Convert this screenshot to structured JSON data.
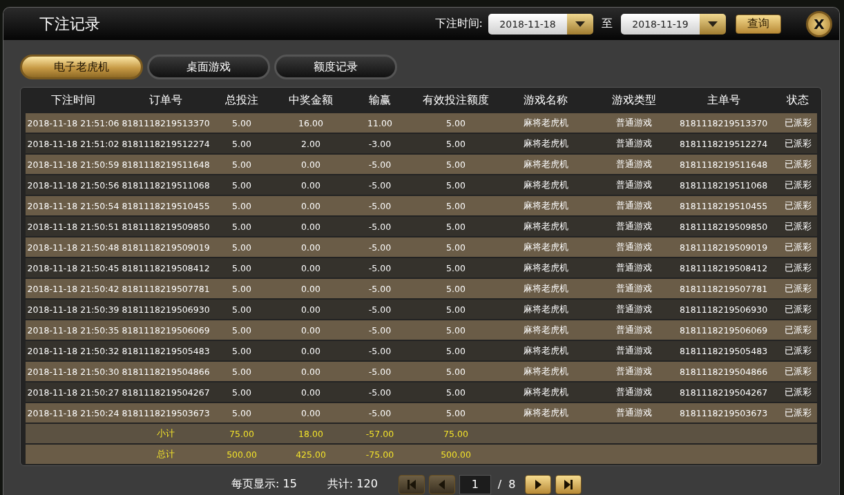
{
  "window": {
    "title": "下注记录"
  },
  "filter": {
    "label": "下注时间:",
    "from": "2018-11-18",
    "separator": "至",
    "to": "2018-11-19",
    "query_button": "查询",
    "close_button": "X"
  },
  "tabs": [
    {
      "label": "电子老虎机",
      "selected": true
    },
    {
      "label": "桌面游戏",
      "selected": false
    },
    {
      "label": "额度记录",
      "selected": false
    }
  ],
  "table": {
    "columns": [
      "下注时间",
      "订单号",
      "总投注",
      "中奖金额",
      "输赢",
      "有效投注额度",
      "游戏名称",
      "游戏类型",
      "主单号",
      "状态"
    ],
    "rows": [
      [
        "2018-11-18 21:51:06",
        "8181118219513370",
        "5.00",
        "16.00",
        "11.00",
        "5.00",
        "麻将老虎机",
        "普通游戏",
        "8181118219513370",
        "已派彩"
      ],
      [
        "2018-11-18 21:51:02",
        "8181118219512274",
        "5.00",
        "2.00",
        "-3.00",
        "5.00",
        "麻将老虎机",
        "普通游戏",
        "8181118219512274",
        "已派彩"
      ],
      [
        "2018-11-18 21:50:59",
        "8181118219511648",
        "5.00",
        "0.00",
        "-5.00",
        "5.00",
        "麻将老虎机",
        "普通游戏",
        "8181118219511648",
        "已派彩"
      ],
      [
        "2018-11-18 21:50:56",
        "8181118219511068",
        "5.00",
        "0.00",
        "-5.00",
        "5.00",
        "麻将老虎机",
        "普通游戏",
        "8181118219511068",
        "已派彩"
      ],
      [
        "2018-11-18 21:50:54",
        "8181118219510455",
        "5.00",
        "0.00",
        "-5.00",
        "5.00",
        "麻将老虎机",
        "普通游戏",
        "8181118219510455",
        "已派彩"
      ],
      [
        "2018-11-18 21:50:51",
        "8181118219509850",
        "5.00",
        "0.00",
        "-5.00",
        "5.00",
        "麻将老虎机",
        "普通游戏",
        "8181118219509850",
        "已派彩"
      ],
      [
        "2018-11-18 21:50:48",
        "8181118219509019",
        "5.00",
        "0.00",
        "-5.00",
        "5.00",
        "麻将老虎机",
        "普通游戏",
        "8181118219509019",
        "已派彩"
      ],
      [
        "2018-11-18 21:50:45",
        "8181118219508412",
        "5.00",
        "0.00",
        "-5.00",
        "5.00",
        "麻将老虎机",
        "普通游戏",
        "8181118219508412",
        "已派彩"
      ],
      [
        "2018-11-18 21:50:42",
        "8181118219507781",
        "5.00",
        "0.00",
        "-5.00",
        "5.00",
        "麻将老虎机",
        "普通游戏",
        "8181118219507781",
        "已派彩"
      ],
      [
        "2018-11-18 21:50:39",
        "8181118219506930",
        "5.00",
        "0.00",
        "-5.00",
        "5.00",
        "麻将老虎机",
        "普通游戏",
        "8181118219506930",
        "已派彩"
      ],
      [
        "2018-11-18 21:50:35",
        "8181118219506069",
        "5.00",
        "0.00",
        "-5.00",
        "5.00",
        "麻将老虎机",
        "普通游戏",
        "8181118219506069",
        "已派彩"
      ],
      [
        "2018-11-18 21:50:32",
        "8181118219505483",
        "5.00",
        "0.00",
        "-5.00",
        "5.00",
        "麻将老虎机",
        "普通游戏",
        "8181118219505483",
        "已派彩"
      ],
      [
        "2018-11-18 21:50:30",
        "8181118219504866",
        "5.00",
        "0.00",
        "-5.00",
        "5.00",
        "麻将老虎机",
        "普通游戏",
        "8181118219504866",
        "已派彩"
      ],
      [
        "2018-11-18 21:50:27",
        "8181118219504267",
        "5.00",
        "0.00",
        "-5.00",
        "5.00",
        "麻将老虎机",
        "普通游戏",
        "8181118219504267",
        "已派彩"
      ],
      [
        "2018-11-18 21:50:24",
        "8181118219503673",
        "5.00",
        "0.00",
        "-5.00",
        "5.00",
        "麻将老虎机",
        "普通游戏",
        "8181118219503673",
        "已派彩"
      ]
    ],
    "summary": [
      {
        "label": "小计",
        "values": [
          "75.00",
          "18.00",
          "-57.00",
          "75.00"
        ]
      },
      {
        "label": "总计",
        "values": [
          "500.00",
          "425.00",
          "-75.00",
          "500.00"
        ]
      }
    ]
  },
  "pager": {
    "per_page": "每页显示: 15",
    "total": "共计: 120",
    "page": "1",
    "separator": "/",
    "pages": "8",
    "buttons": [
      {
        "kind": "first",
        "disabled": true
      },
      {
        "kind": "prev",
        "disabled": true
      },
      {
        "kind": "next",
        "disabled": false
      },
      {
        "kind": "last",
        "disabled": false
      }
    ]
  }
}
